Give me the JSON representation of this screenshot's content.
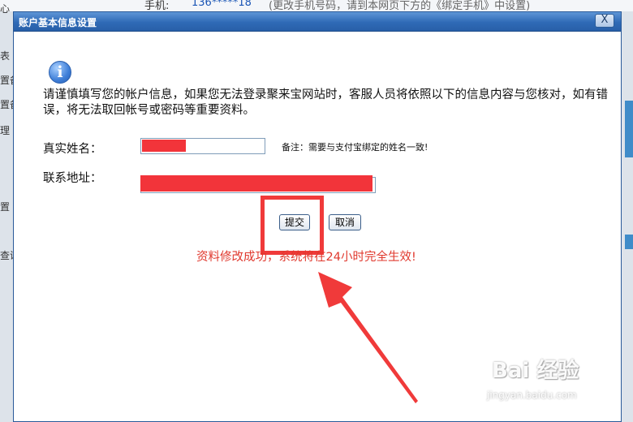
{
  "background": {
    "left_fragments": [
      "心",
      "表",
      "置备",
      "置备",
      "理",
      "置",
      "查询"
    ],
    "phone_label": "手机:",
    "phone_value": "136*****18",
    "phone_hint": "(更改手机号码，请到本网页下方的《绑定手机》中设置)"
  },
  "dialog": {
    "title": "账户基本信息设置",
    "close_label": "X",
    "info_icon_glyph": "i",
    "notice": "请谨慎填写您的帐户信息，如果您无法登录聚来宝网站时，客服人员将依照以下的信息内容与您核对，如有错误，将无法取回帐号或密码等重要资料。",
    "form": {
      "realname_label": "真实姓名：",
      "realname_value": "",
      "realname_remark": "备注：需要与支付宝绑定的姓名一致!",
      "address_label": "联系地址：",
      "address_value": ""
    },
    "buttons": {
      "submit": "提交",
      "cancel": "取消"
    },
    "success_message": "资料修改成功，系统将在24小时完全生效!"
  },
  "annotations": {
    "highlight_color": "#f03a3a",
    "arrow_color": "#f03a3a",
    "redaction_color": "#f2343a"
  },
  "watermark": {
    "brand": "Bai 经验",
    "url": "jingyan.baidu.com"
  }
}
